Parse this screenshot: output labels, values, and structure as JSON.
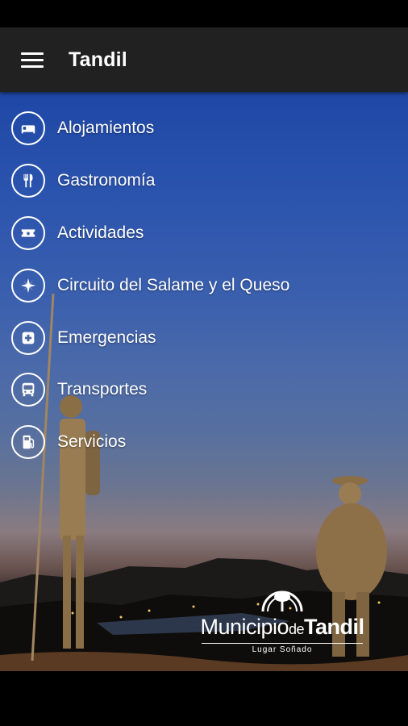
{
  "app_bar": {
    "title": "Tandil"
  },
  "menu": {
    "items": [
      {
        "label": "Alojamientos",
        "icon": "bed-icon"
      },
      {
        "label": "Gastronomía",
        "icon": "fork-knife-icon"
      },
      {
        "label": "Actividades",
        "icon": "ticket-icon"
      },
      {
        "label": "Circuito del Salame y el Queso",
        "icon": "compass-rose-icon"
      },
      {
        "label": "Emergencias",
        "icon": "first-aid-icon"
      },
      {
        "label": "Transportes",
        "icon": "bus-icon"
      },
      {
        "label": "Servicios",
        "icon": "fuel-pump-icon"
      }
    ]
  },
  "logo": {
    "municipio": "Municipio",
    "de": "de",
    "tandil": "Tandil",
    "tagline": "Lugar Soñado"
  },
  "colors": {
    "app_bar": "#212121",
    "sky_top": "#1f47a6",
    "icon_stroke": "#ffffff"
  }
}
